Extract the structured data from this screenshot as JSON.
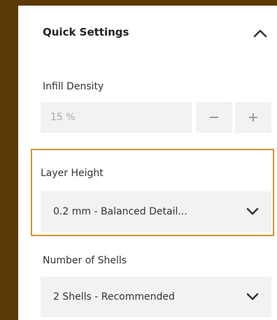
{
  "panel": {
    "title": "Quick Settings",
    "collapse_icon": "chevron-up-icon"
  },
  "infill": {
    "label": "Infill Density",
    "value": "15 %",
    "minus_label": "−",
    "plus_label": "+"
  },
  "layer_height": {
    "label": "Layer Height",
    "selected": "0.2 mm - Balanced Detail...",
    "chevron_icon": "chevron-down-icon"
  },
  "shells": {
    "label": "Number of Shells",
    "selected": "2 Shells - Recommended",
    "chevron_icon": "chevron-down-icon"
  },
  "colors": {
    "background": "#5b3a06",
    "panel": "#ffffff",
    "focus_border": "#c8962a",
    "field_bg": "#f2f2f2"
  }
}
